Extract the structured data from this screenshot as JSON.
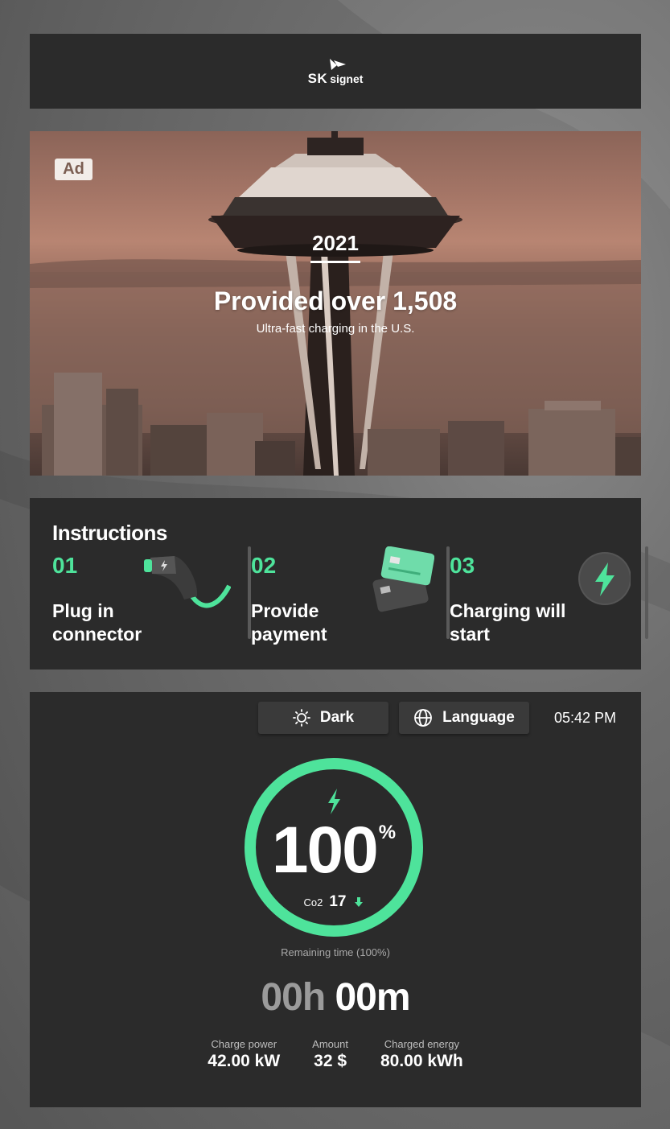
{
  "brand": {
    "logo_sk": "SK",
    "logo_signet": "signet"
  },
  "ad": {
    "badge": "Ad",
    "year": "2021",
    "headline": "Provided over 1,508",
    "subline": "Ultra-fast charging in the U.S."
  },
  "instructions": {
    "title": "Instructions",
    "steps": [
      {
        "num": "01",
        "text": "Plug in connector",
        "icon": "connector-plug-icon"
      },
      {
        "num": "02",
        "text": "Provide payment",
        "icon": "credit-card-icon"
      },
      {
        "num": "03",
        "text": "Charging will start",
        "icon": "lightning-icon"
      }
    ]
  },
  "controls": {
    "theme_label": "Dark",
    "language_label": "Language",
    "time": "05:42 PM"
  },
  "charging": {
    "percent": "100",
    "percent_sign": "%",
    "percent_value": 100,
    "co2_label": "Co2",
    "co2_value": "17",
    "remaining_label": "Remaining time (100%)",
    "remaining_hours": "00h",
    "remaining_minutes": "00m",
    "stats": [
      {
        "label": "Charge power",
        "value": "42.00 kW"
      },
      {
        "label": "Amount",
        "value": "32 $"
      },
      {
        "label": "Charged energy",
        "value": "80.00 kWh"
      }
    ]
  },
  "colors": {
    "accent": "#4ee39b",
    "panel": "#2b2b2b"
  }
}
